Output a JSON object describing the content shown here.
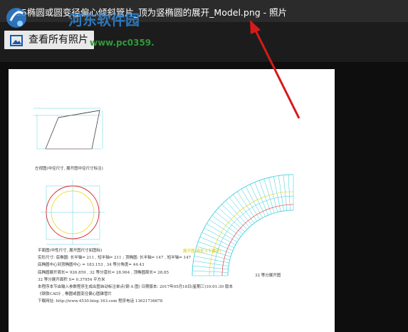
{
  "window": {
    "title": "15椭圆或圆变径偏心倾斜管片_顶为竖椭圆的展开_Model.png - 照片"
  },
  "watermark": {
    "site_name": "河东软件园",
    "url": "www.pc0359.cn"
  },
  "toolbar": {
    "view_all_label": "查看所有照片"
  },
  "drawing": {
    "caption_front_view": "左视图(中径尺寸, 展开图中径尺寸标注)",
    "caption_unfold_label": "展开图(扇形上下展开)",
    "caption_equal_divisions": "32 等分展开图",
    "notes": [
      "平面图(中性尺寸, 展开图尺寸如图标)",
      "实形尺寸: 底椭圆: 长半轴= 211 , 短半轴= 211 ; 顶椭圆: 长半轴= 147 , 短半轴= 147",
      "底椭圆中心到顶椭圆中心 = 183.153 , 34 等分角度= 44.43",
      "底椭圆展开周长= 926.859 , 32 等分弧长= 28.964 , 顶椭圆周长= 28.85",
      "32 等分展开面积 S= 0.37954 平方米",
      "本程序本节由输入参数程序生成出图自动标注单点(钢 A 图) 日期版本: 2017年05月18日(星期三)10:01:30 版本",
      "《钢铁CAD》, 椭圆或圆变径偏心圆锥管片",
      "下载网址: http://www.4530.blog.163.com 程序电话 13621736678"
    ]
  },
  "colors": {
    "titlebar_bg": "#2b2b2b",
    "viewer_bg": "#0e0e0e",
    "red_arrow": "#d61a1a",
    "cad_red": "#e0202a",
    "cad_cyan": "#35c8dc",
    "cad_yellow": "#e0d600"
  }
}
